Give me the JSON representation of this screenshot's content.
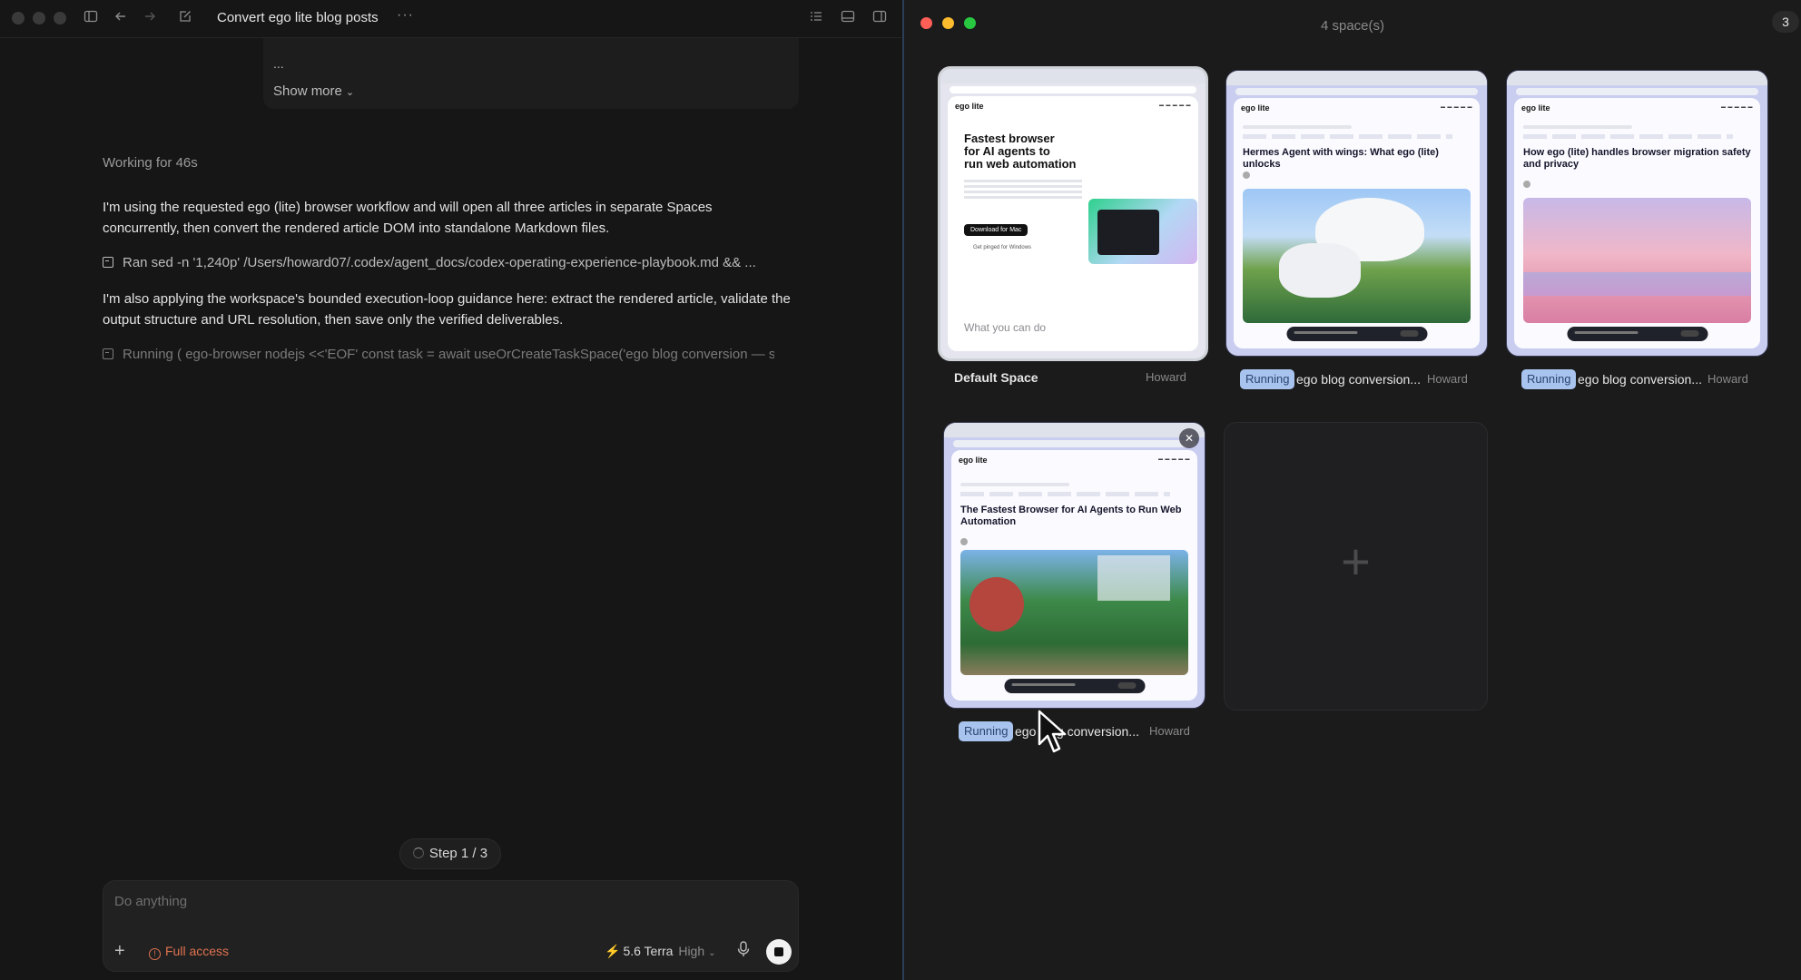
{
  "left": {
    "title": "Convert ego lite blog posts",
    "more_label": "···",
    "prev_ellipsis": "...",
    "show_more": "Show more",
    "working": "Working for 46s",
    "para1": "I'm using the requested ego (lite) browser workflow and will open all three articles in separate Spaces concurrently, then convert the rendered article DOM into standalone Markdown files.",
    "cmd1": "Ran sed -n '1,240p' /Users/howard07/.codex/agent_docs/codex-operating-experience-playbook.md && ...",
    "para2": "I'm also applying the workspace's bounded execution-loop guidance here: extract the rendered article, validate the output structure and URL resolution, then save only the verified deliverables.",
    "cmd2": "Running ( ego-browser nodejs <<'EOF' const task = await useOrCreateTaskSpace('ego blog conversion — s",
    "step": "Step 1 / 3",
    "composer": {
      "placeholder": "Do anything",
      "plus": "+",
      "access": "Full access",
      "model": "5.6 Terra",
      "level": "High"
    }
  },
  "right": {
    "title": "4 space(s)",
    "badge": "3",
    "spaces": [
      {
        "name": "Default Space",
        "owner": "Howard",
        "status": "",
        "preview": {
          "logo": "ego lite",
          "heading_line1": "Fastest browser",
          "heading_line2": "for AI agents to",
          "heading_line3": "run web automation",
          "button": "Download for Mac",
          "secondary": "Get pinged for Windows",
          "footer": "What you can do"
        }
      },
      {
        "name": "ego blog conversion...",
        "owner": "Howard",
        "status": "Running",
        "preview": {
          "logo": "ego lite",
          "heading": "Hermes Agent with wings: What ego (lite) unlocks"
        }
      },
      {
        "name": "ego blog conversion...",
        "owner": "Howard",
        "status": "Running",
        "preview": {
          "logo": "ego lite",
          "heading": "How ego (lite) handles browser migration safety and privacy"
        }
      },
      {
        "name": "ego blog conversion...",
        "owner": "Howard",
        "status": "Running",
        "preview": {
          "logo": "ego lite",
          "heading": "The Fastest Browser for AI Agents to Run Web Automation"
        }
      }
    ],
    "add_space": "+",
    "close": "✕"
  },
  "colors": {
    "accent_running": "#a8c4ee",
    "warning": "#e0734f",
    "mac_red": "#ff5f57",
    "mac_yellow": "#febc2e",
    "mac_green": "#28c840"
  }
}
